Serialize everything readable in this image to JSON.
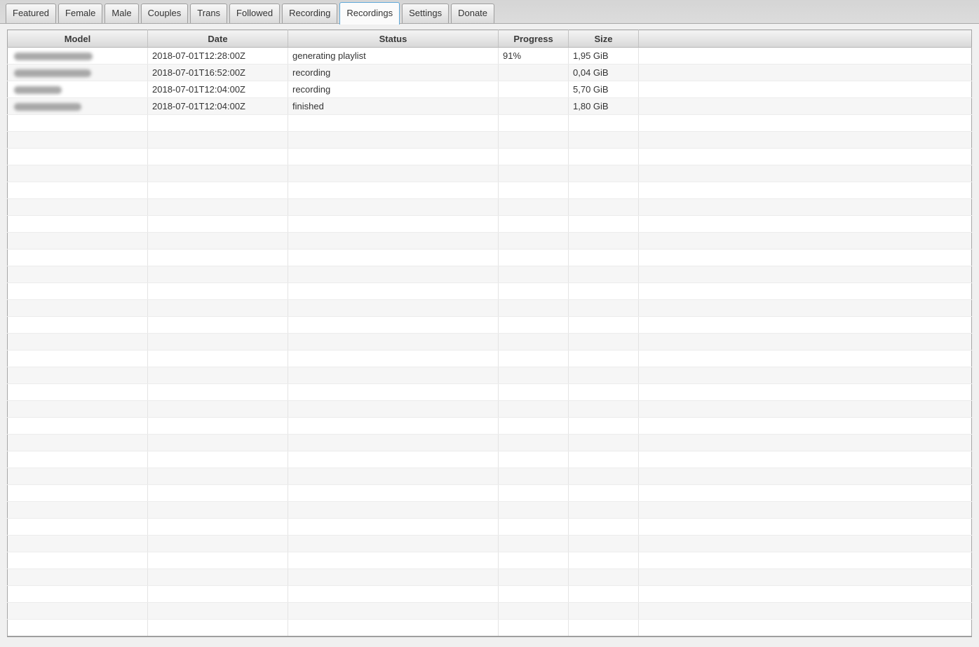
{
  "tabs": {
    "items": [
      {
        "label": "Featured",
        "active": false
      },
      {
        "label": "Female",
        "active": false
      },
      {
        "label": "Male",
        "active": false
      },
      {
        "label": "Couples",
        "active": false
      },
      {
        "label": "Trans",
        "active": false
      },
      {
        "label": "Followed",
        "active": false
      },
      {
        "label": "Recording",
        "active": false
      },
      {
        "label": "Recordings",
        "active": true
      },
      {
        "label": "Settings",
        "active": false
      },
      {
        "label": "Donate",
        "active": false
      }
    ]
  },
  "table": {
    "columns": [
      {
        "key": "model",
        "label": "Model"
      },
      {
        "key": "date",
        "label": "Date"
      },
      {
        "key": "status",
        "label": "Status"
      },
      {
        "key": "progress",
        "label": "Progress"
      },
      {
        "key": "size",
        "label": "Size"
      },
      {
        "key": "filler",
        "label": ""
      }
    ],
    "rows": [
      {
        "model": "",
        "model_redacted": true,
        "model_redacted_width": 112,
        "date": "2018-07-01T12:28:00Z",
        "status": "generating playlist",
        "progress": "91%",
        "size": "1,95 GiB"
      },
      {
        "model": "",
        "model_redacted": true,
        "model_redacted_width": 110,
        "date": "2018-07-01T16:52:00Z",
        "status": "recording",
        "progress": "",
        "size": "0,04 GiB"
      },
      {
        "model": "",
        "model_redacted": true,
        "model_redacted_width": 68,
        "date": "2018-07-01T12:04:00Z",
        "status": "recording",
        "progress": "",
        "size": "5,70 GiB"
      },
      {
        "model": "",
        "model_redacted": true,
        "model_redacted_width": 96,
        "date": "2018-07-01T12:04:00Z",
        "status": "finished",
        "progress": "",
        "size": "1,80 GiB"
      }
    ],
    "empty_row_count": 31
  },
  "colors": {
    "active_tab_border": "#5fa8d8",
    "stripe_row": "#f6f6f6",
    "header_text": "#3a3a3a"
  }
}
